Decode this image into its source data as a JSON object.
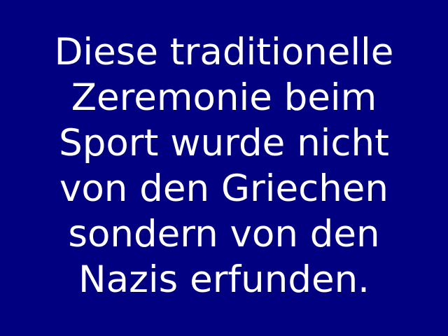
{
  "colors": {
    "background": "#000080",
    "text": "#ffffff"
  },
  "message": {
    "lines": [
      "Diese traditionelle",
      "Zeremonie beim",
      "Sport wurde nicht",
      "von den Griechen",
      "sondern von den",
      "Nazis erfunden."
    ]
  }
}
